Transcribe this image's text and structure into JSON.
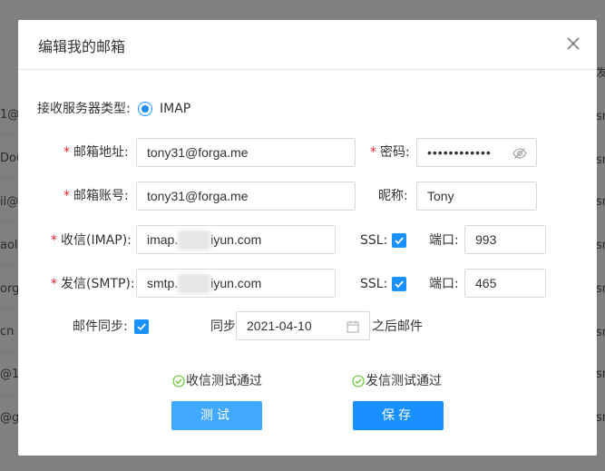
{
  "background": {
    "left_fragments": [
      "1@",
      "Dou",
      "il@",
      "aol.",
      "org",
      "cn",
      "@1",
      "@g"
    ],
    "right_fragments": [
      "发",
      "sn",
      "sn",
      "sn",
      "sn",
      "sn",
      "sn",
      "sn",
      "sn",
      "sn"
    ]
  },
  "dialog": {
    "title": "编辑我的邮箱",
    "protocol_label": "接收服务器类型:",
    "protocol_value": "IMAP",
    "email_label": "邮箱地址:",
    "email_value": "tony31@forga.me",
    "password_label": "密码:",
    "password_value": "••••••••••••",
    "account_label": "邮箱账号:",
    "account_value": "tony31@forga.me",
    "nickname_label": "昵称:",
    "nickname_value": "Tony",
    "imap_label": "收信(IMAP):",
    "imap_server_prefix": "imap.",
    "imap_server_suffix": "iyun.com",
    "smtp_label": "发信(SMTP):",
    "smtp_server_prefix": "smtp.",
    "smtp_server_suffix": "iyun.com",
    "ssl_label": "SSL:",
    "port_label": "端口:",
    "imap_port": "993",
    "smtp_port": "465",
    "sync_label": "邮件同步:",
    "sync_from_label": "同步",
    "sync_date": "2021-04-10",
    "sync_after_label": "之后邮件",
    "receive_status": "收信测试通过",
    "send_status": "发信测试通过",
    "test_button": "测试",
    "save_button": "保存"
  },
  "colors": {
    "primary": "#1890ff",
    "required": "#f5222d",
    "success": "#52c41a"
  }
}
